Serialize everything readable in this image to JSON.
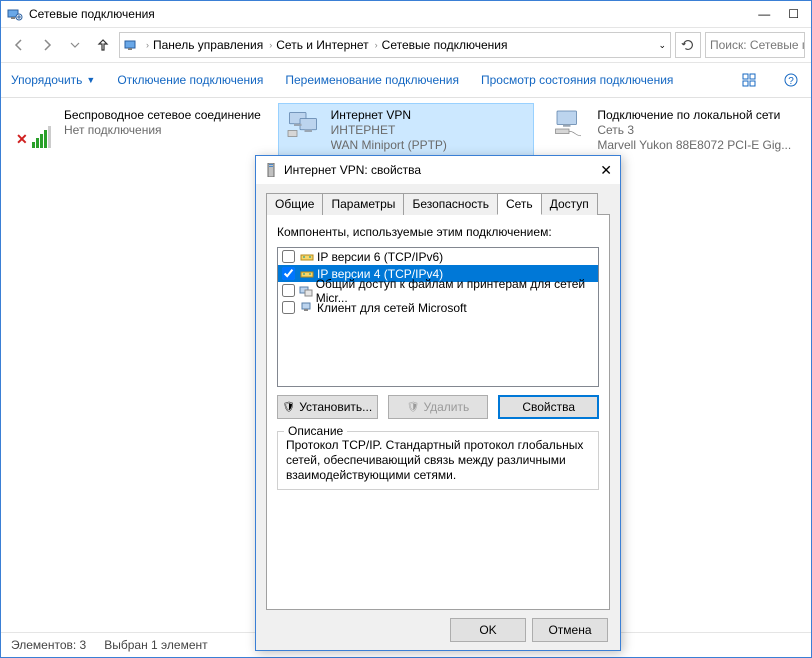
{
  "window": {
    "title": "Сетевые подключения"
  },
  "breadcrumb": {
    "items": [
      "Панель управления",
      "Сеть и Интернет",
      "Сетевые подключения"
    ],
    "dropdown_icon": "chevron-down",
    "refresh_icon": "refresh"
  },
  "search": {
    "placeholder": "Поиск: Сетевые п"
  },
  "commands": {
    "arrange": "Упорядочить",
    "disable": "Отключение подключения",
    "rename": "Переименование подключения",
    "view_status": "Просмотр состояния подключения"
  },
  "connections": [
    {
      "title": "Беспроводное сетевое соединение",
      "status": "Нет подключения",
      "adapter": "",
      "selected": false,
      "icon": "wifi-disconnected"
    },
    {
      "title": "Интернет  VPN",
      "status": "ИНТЕРНЕТ",
      "adapter": "WAN Miniport (PPTP)",
      "selected": true,
      "icon": "vpn"
    },
    {
      "title": "Подключение по локальной сети",
      "status": "Сеть 3",
      "adapter": "Marvell Yukon 88E8072 PCI-E Gig...",
      "selected": false,
      "icon": "ethernet"
    }
  ],
  "statusbar": {
    "count_label": "Элементов: 3",
    "selection_label": "Выбран 1 элемент"
  },
  "dialog": {
    "title": "Интернет  VPN: свойства",
    "tabs": [
      "Общие",
      "Параметры",
      "Безопасность",
      "Сеть",
      "Доступ"
    ],
    "active_tab": 3,
    "components_label": "Компоненты, используемые этим подключением:",
    "components": [
      {
        "checked": false,
        "label": "IP версии 6 (TCP/IPv6)",
        "selected": false
      },
      {
        "checked": true,
        "label": "IP версии 4 (TCP/IPv4)",
        "selected": true
      },
      {
        "checked": false,
        "label": "Общий доступ к файлам и принтерам для сетей Micr...",
        "selected": false
      },
      {
        "checked": false,
        "label": "Клиент для сетей Microsoft",
        "selected": false
      }
    ],
    "buttons": {
      "install": "Установить...",
      "uninstall": "Удалить",
      "properties": "Свойства"
    },
    "description": {
      "legend": "Описание",
      "text": "Протокол TCP/IP. Стандартный протокол глобальных сетей, обеспечивающий связь между различными взаимодействующими сетями."
    },
    "footer": {
      "ok": "OK",
      "cancel": "Отмена"
    }
  }
}
